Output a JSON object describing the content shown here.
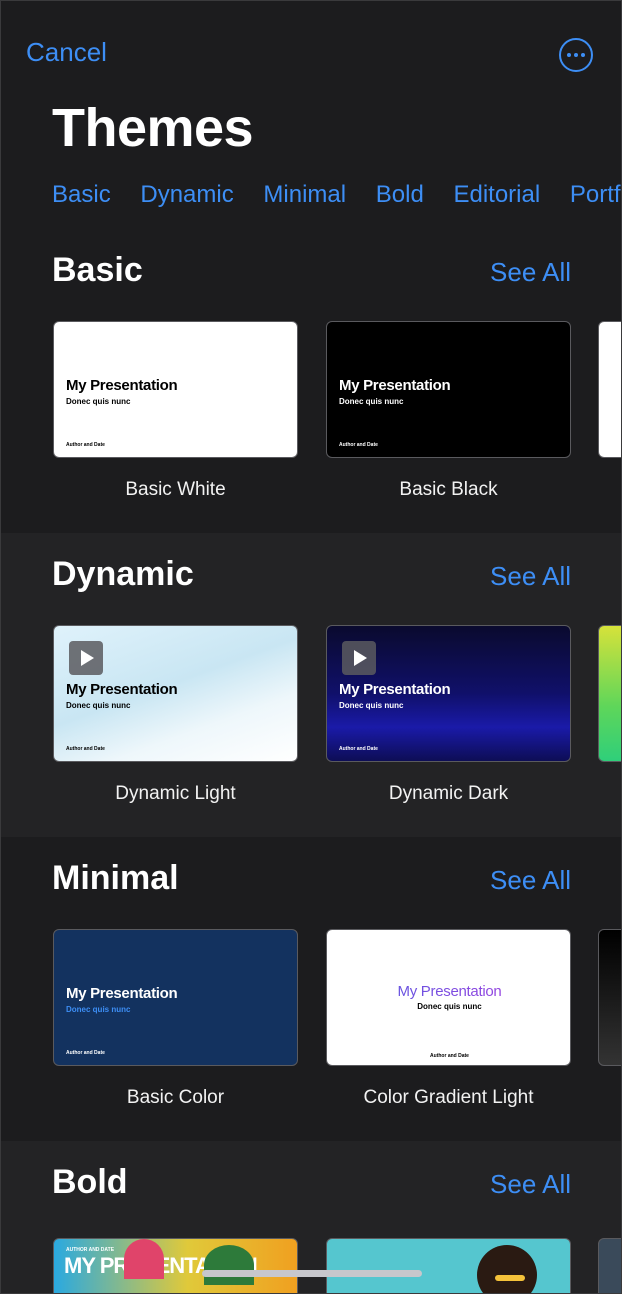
{
  "nav": {
    "cancel": "Cancel",
    "more_icon": "ellipsis-circle-icon"
  },
  "title": "Themes",
  "categories": [
    "Basic",
    "Dynamic",
    "Minimal",
    "Bold",
    "Editorial",
    "Portfo"
  ],
  "see_all": "See All",
  "slide": {
    "title": "My Presentation",
    "subtitle": "Donec quis nunc",
    "author": "Author and Date"
  },
  "sections": [
    {
      "title": "Basic",
      "themes": [
        "Basic White",
        "Basic Black"
      ]
    },
    {
      "title": "Dynamic",
      "themes": [
        "Dynamic Light",
        "Dynamic Dark"
      ]
    },
    {
      "title": "Minimal",
      "themes": [
        "Basic Color",
        "Color Gradient Light"
      ]
    },
    {
      "title": "Bold",
      "themes_visible_art": [
        "MY PRESENTATION",
        "AUTHOR AND DATE"
      ]
    }
  ],
  "colors": {
    "accent": "#3d8ef5",
    "background": "#1c1c1e",
    "section_alt": "#232325"
  }
}
